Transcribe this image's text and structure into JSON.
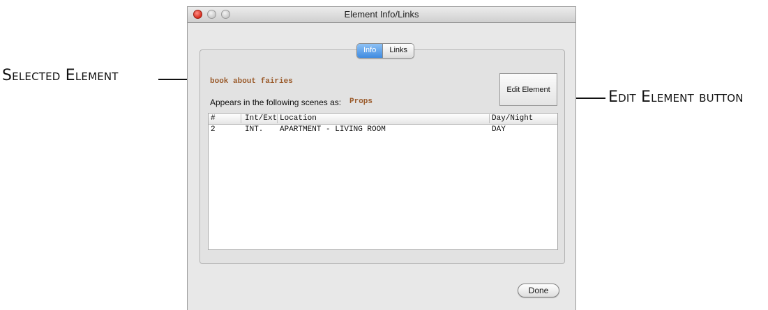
{
  "callouts": {
    "selected_element": "Selected Element",
    "edit_element_button": "Edit Element button"
  },
  "window": {
    "title": "Element Info/Links"
  },
  "tabs": [
    {
      "label": "Info",
      "active": true
    },
    {
      "label": "Links",
      "active": false
    }
  ],
  "element": {
    "name": "book about fairies",
    "appears_label": "Appears in the following scenes as:",
    "category": "Props"
  },
  "edit_button_label": "Edit Element",
  "table": {
    "headers": [
      "#",
      "Int/Ext",
      "Location",
      "Day/Night"
    ],
    "rows": [
      [
        "2",
        "INT.",
        "APARTMENT - LIVING ROOM",
        "DAY"
      ]
    ]
  },
  "done_label": "Done",
  "colors": {
    "accent_tab": "#3f8be0",
    "element_text": "#9a5a2a"
  }
}
